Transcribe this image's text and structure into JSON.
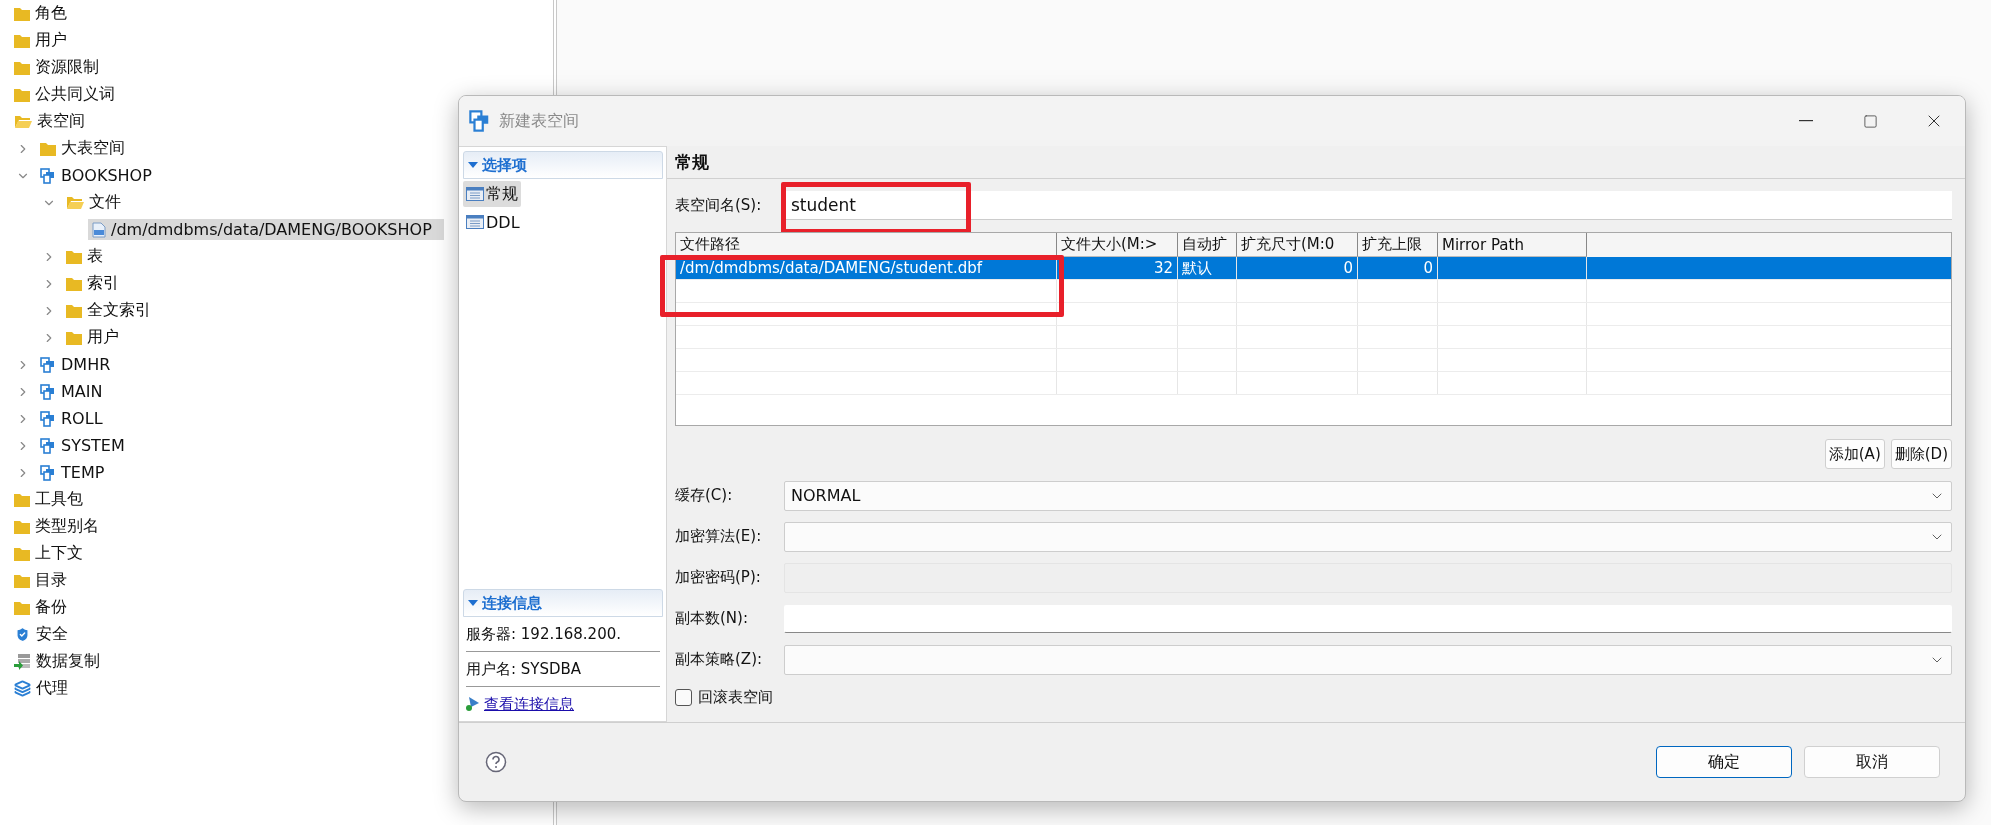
{
  "tree": [
    {
      "label": "角色",
      "kind": "folder",
      "selected": false
    },
    {
      "label": "用户",
      "kind": "folder",
      "selected": false
    },
    {
      "label": "资源限制",
      "kind": "folder",
      "selected": false
    },
    {
      "label": "公共同义词",
      "kind": "folder",
      "selected": false
    },
    {
      "label": "表空间",
      "kind": "folder",
      "selected": false,
      "expanded": true,
      "children": [
        {
          "label": "大表空间",
          "kind": "folder",
          "selected": false,
          "expanded": false
        },
        {
          "label": "BOOKSHOP",
          "kind": "tablespace",
          "selected": false,
          "expanded": true,
          "children": [
            {
              "label": "文件",
              "kind": "folder",
              "selected": false,
              "expanded": true,
              "children": [
                {
                  "label": "/dm/dmdbms/data/DAMENG/BOOKSHOP",
                  "kind": "file",
                  "selected": true
                }
              ]
            },
            {
              "label": "表",
              "kind": "folder",
              "selected": false,
              "expanded": false
            },
            {
              "label": "索引",
              "kind": "folder",
              "selected": false,
              "expanded": false
            },
            {
              "label": "全文索引",
              "kind": "folder",
              "selected": false,
              "expanded": false
            },
            {
              "label": "用户",
              "kind": "folder",
              "selected": false,
              "expanded": false
            }
          ]
        },
        {
          "label": "DMHR",
          "kind": "tablespace",
          "selected": false,
          "expanded": false
        },
        {
          "label": "MAIN",
          "kind": "tablespace",
          "selected": false,
          "expanded": false
        },
        {
          "label": "ROLL",
          "kind": "tablespace",
          "selected": false,
          "expanded": false
        },
        {
          "label": "SYSTEM",
          "kind": "tablespace",
          "selected": false,
          "expanded": false
        },
        {
          "label": "TEMP",
          "kind": "tablespace",
          "selected": false,
          "expanded": false
        }
      ]
    },
    {
      "label": "工具包",
      "kind": "folder",
      "selected": false
    },
    {
      "label": "类型别名",
      "kind": "folder",
      "selected": false
    },
    {
      "label": "上下文",
      "kind": "folder",
      "selected": false
    },
    {
      "label": "目录",
      "kind": "folder",
      "selected": false
    },
    {
      "label": "备份",
      "kind": "folder",
      "selected": false
    },
    {
      "label": "安全",
      "kind": "shield",
      "selected": false
    },
    {
      "label": "数据复制",
      "kind": "replication",
      "selected": false
    },
    {
      "label": "代理",
      "kind": "layers",
      "selected": false
    }
  ],
  "dialog": {
    "title": "新建表空间",
    "options": {
      "title": "选择项",
      "items": [
        {
          "label": "常规",
          "selected": true
        },
        {
          "label": "DDL",
          "selected": false
        }
      ]
    },
    "connection": {
      "title": "连接信息",
      "server": "服务器: 192.168.200.",
      "user": "用户名: SYSDBA",
      "link": "查看连接信息"
    },
    "heading": "常规",
    "name": {
      "label": "表空间名(S):",
      "value": "student",
      "highlighted": true
    },
    "files": {
      "columns": [
        "文件路径",
        "文件大小(M:>",
        "自动扩",
        "扩充尺寸(M:0",
        "扩充上限",
        "Mirror Path"
      ],
      "rows": [
        {
          "cells": [
            "/dm/dmdbms/data/DAMENG/student.dbf",
            "32",
            "默认",
            "0",
            "0"
          ],
          "selected": true,
          "highlighted": true
        }
      ]
    },
    "table_buttons": [
      "添加(A)",
      "删除(D)"
    ],
    "fields": [
      {
        "label": "缓存(C):",
        "kind": "select",
        "value": "NORMAL"
      },
      {
        "label": "加密算法(E):",
        "kind": "select"
      },
      {
        "label": "加密密码(P):",
        "kind": "disabled"
      },
      {
        "label": "副本数(N):",
        "kind": "text"
      },
      {
        "label": "副本策略(Z):",
        "kind": "select"
      }
    ],
    "rollback": {
      "label": "回滚表空间",
      "checked": false
    },
    "buttons": [
      "确定",
      "取消"
    ]
  }
}
